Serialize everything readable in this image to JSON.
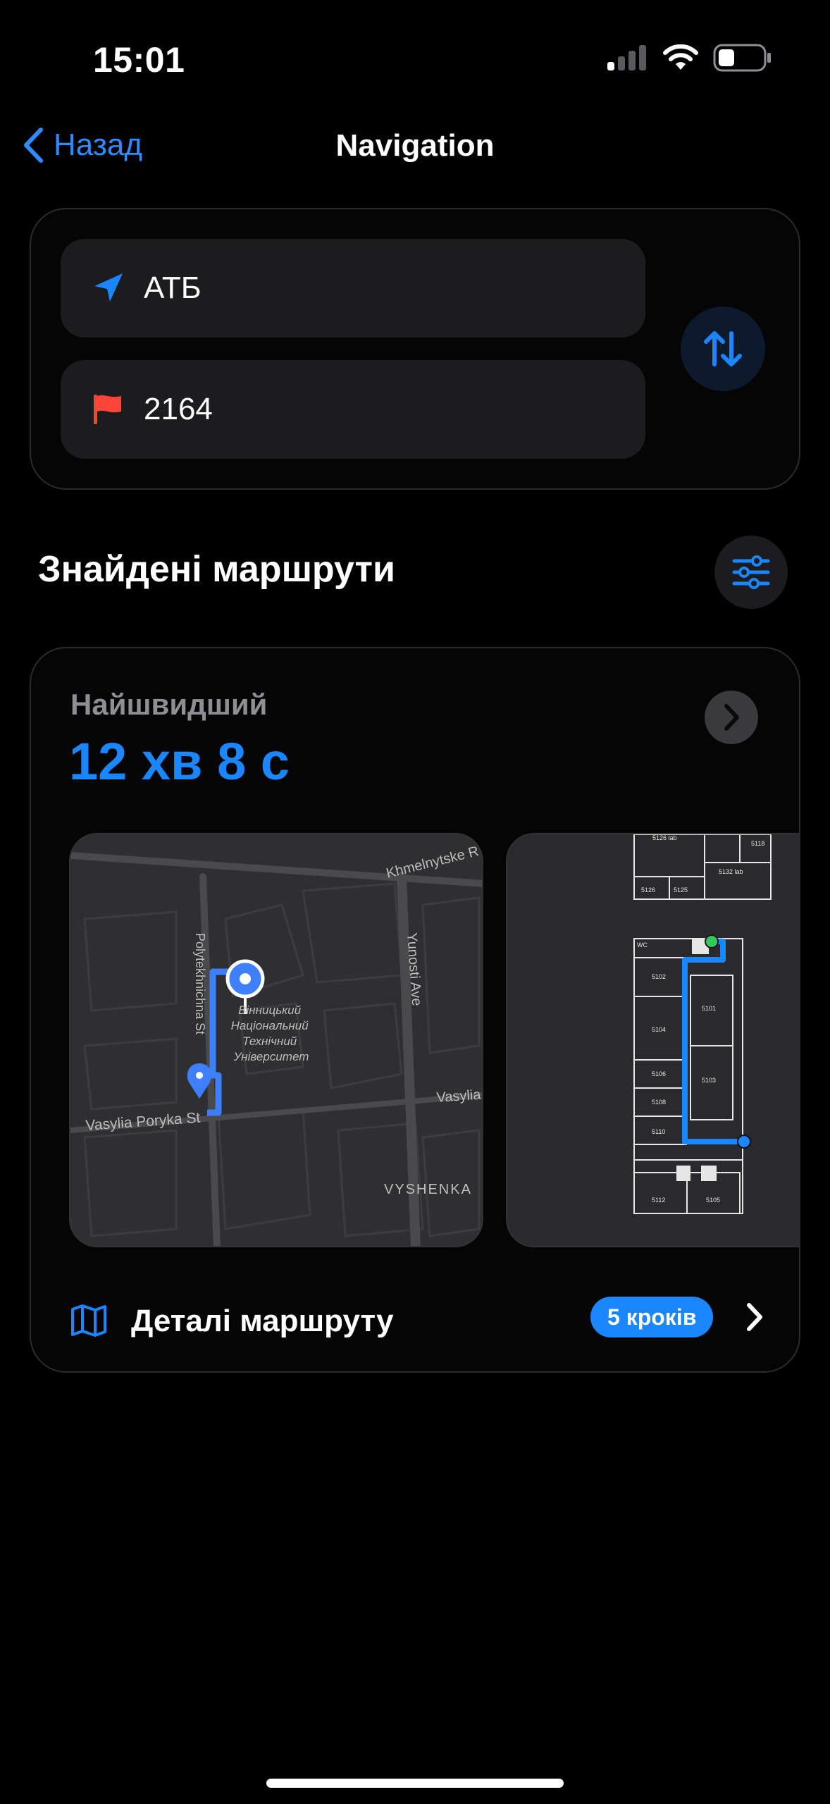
{
  "status_bar": {
    "time": "15:01"
  },
  "nav": {
    "back_label": "Назад",
    "title": "Navigation"
  },
  "route_input": {
    "from": {
      "icon": "location-arrow-icon",
      "value": "АТБ"
    },
    "to": {
      "icon": "red-flag-icon",
      "value": "2164"
    },
    "swap_icon": "swap-arrows-icon"
  },
  "results": {
    "title": "Знайдені маршрути",
    "filter_icon": "sliders-icon"
  },
  "route": {
    "kind": "Найшвидший",
    "duration": "12 хв 8 с",
    "map": {
      "labels": {
        "street_1": "Khmelnytske R",
        "street_2": "Polytekhnichna St",
        "street_3": "Yunosti Ave",
        "street_4": "Vasylia Poryka St",
        "street_5": "Vasylia",
        "district": "VYSHENKA",
        "poi_line1": "Вінницький",
        "poi_line2": "Національний",
        "poi_line3": "Технічний",
        "poi_line4": "Університет"
      }
    },
    "floor_plan": {
      "rooms": [
        "5126 lab",
        "5118",
        "5126",
        "5125",
        "5132 lab",
        "WC",
        "5102",
        "5101",
        "5104",
        "5103",
        "5106",
        "5108",
        "5110",
        "5112",
        "5105"
      ]
    },
    "details_label": "Деталі маршруту",
    "steps_badge": "5 кроків"
  },
  "colors": {
    "accent": "#1a86ff",
    "flag": "#ff453a",
    "background": "#000000",
    "field": "#1c1c1e"
  }
}
